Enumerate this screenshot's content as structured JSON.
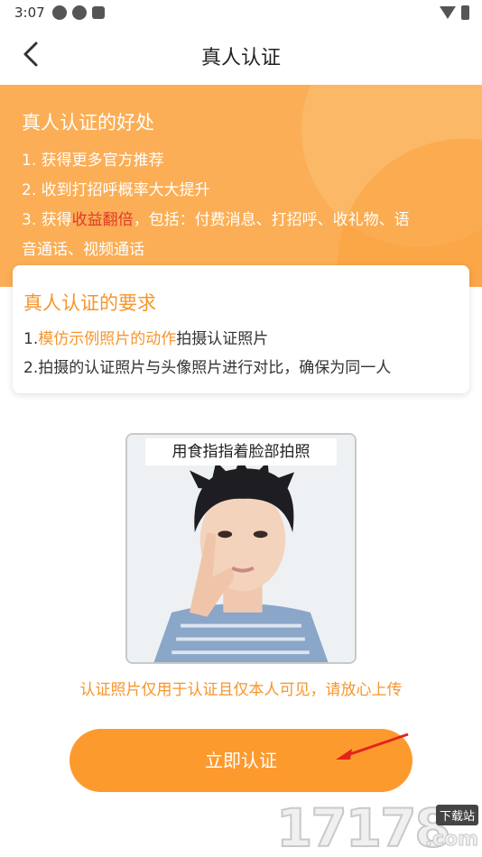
{
  "status_bar": {
    "time": "3:07"
  },
  "nav": {
    "title": "真人认证"
  },
  "benefits": {
    "title": "真人认证的好处",
    "line1": "1. 获得更多官方推荐",
    "line2": "2. 收到打招呼概率大大提升",
    "line3_prefix": "3. 获得",
    "line3_highlight": "收益翻倍",
    "line3_suffix": "，包括：付费消息、打招呼、收礼物、语",
    "line4": "音通话、视频通话"
  },
  "requirements": {
    "title": "真人认证的要求",
    "line1_prefix": "1.",
    "line1_highlight": "模仿示例照片的动作",
    "line1_suffix": "拍摄认证照片",
    "line2": "2.拍摄的认证照片与头像照片进行对比，确保为同一人"
  },
  "sample_photo": {
    "caption": "用食指指着脸部拍照"
  },
  "privacy_note": "认证照片仅用于认证且仅本人可见，请放心上传",
  "verify_button": "立即认证",
  "watermark": {
    "digits": "17178",
    "tag": "下载站",
    "com": ".com"
  },
  "colors": {
    "accent": "#fd9a2e",
    "header_bg": "#fbae55",
    "highlight_red": "#e0392a",
    "highlight_orange": "#f5962c"
  }
}
